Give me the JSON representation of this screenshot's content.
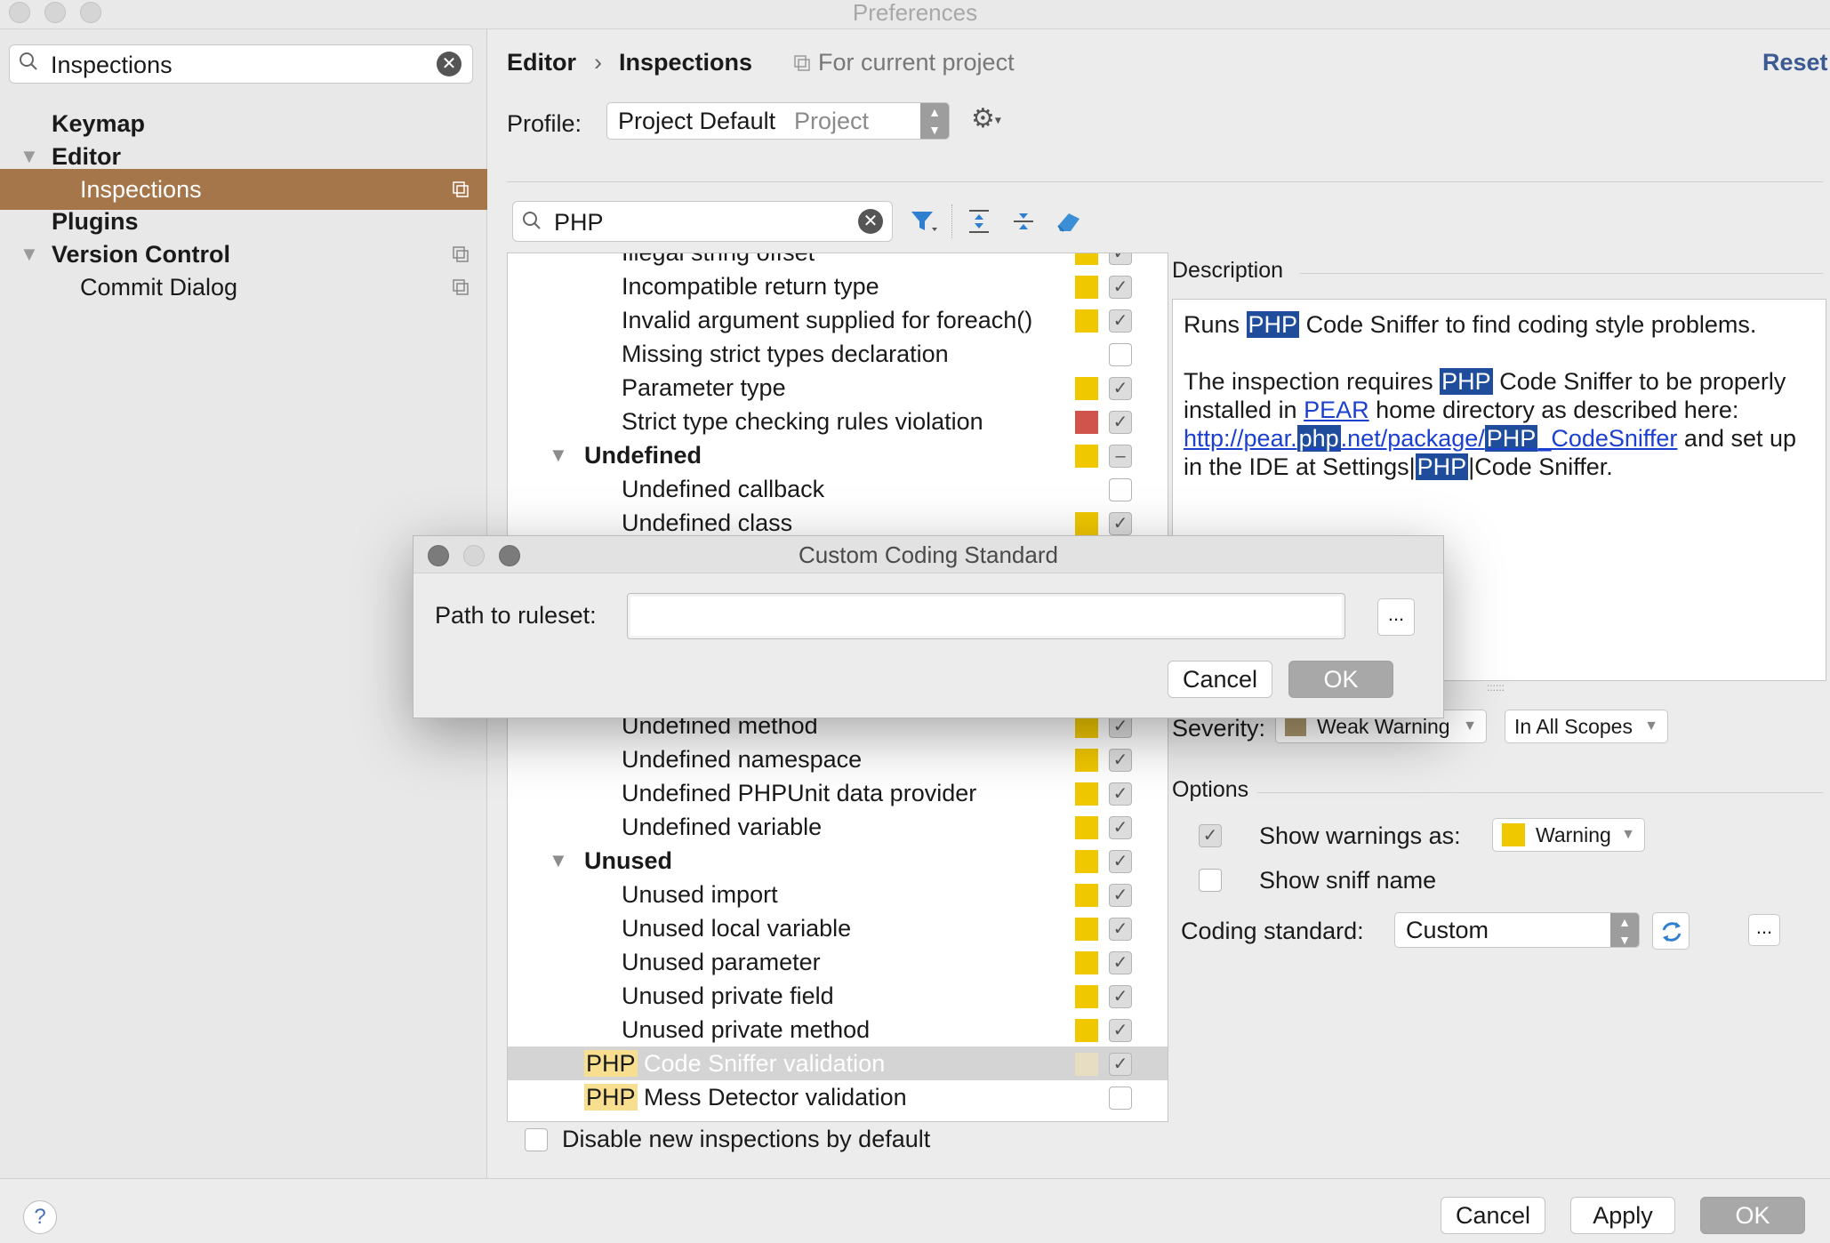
{
  "window": {
    "title": "Preferences"
  },
  "sidebar": {
    "search_value": "Inspections",
    "items": [
      {
        "label": "Keymap",
        "bold": true
      },
      {
        "label": "Editor",
        "bold": true
      },
      {
        "label": "Inspections",
        "selected": true
      },
      {
        "label": "Plugins",
        "bold": true
      },
      {
        "label": "Version Control",
        "bold": true
      },
      {
        "label": "Commit Dialog"
      }
    ]
  },
  "header": {
    "crumb1": "Editor",
    "sep": "›",
    "crumb2": "Inspections",
    "scope": "For current project",
    "reset": "Reset"
  },
  "profile": {
    "label": "Profile:",
    "value": "Project Default",
    "kind": "Project"
  },
  "filter": {
    "value": "PHP"
  },
  "tree": {
    "rows": [
      {
        "text": "Illegal string offset"
      },
      {
        "text": "Incompatible return type"
      },
      {
        "text": "Invalid argument supplied for foreach()"
      },
      {
        "text": "Missing strict types declaration"
      },
      {
        "text": "Parameter type"
      },
      {
        "text": "Strict type checking rules violation"
      },
      {
        "text": "Undefined"
      },
      {
        "text": "Undefined callback"
      },
      {
        "text": "Undefined class"
      },
      {
        "text": "Undefined method"
      },
      {
        "text": "Undefined namespace"
      },
      {
        "text": "Undefined PHPUnit data provider"
      },
      {
        "text": "Undefined variable"
      },
      {
        "text": "Unused"
      },
      {
        "text": "Unused import"
      },
      {
        "text": "Unused local variable"
      },
      {
        "text": "Unused parameter"
      },
      {
        "text": "Unused private field"
      },
      {
        "text": "Unused private method"
      },
      {
        "prefix": "PHP",
        "text": " Code Sniffer validation"
      },
      {
        "prefix": "PHP",
        "text": " Mess Detector validation"
      }
    ],
    "disable_new_label": "Disable new inspections by default"
  },
  "colors": {
    "warning": "#f0c800",
    "error": "#d0534c",
    "weak_warning": "#a8956b",
    "selection": "#a5764a",
    "highlight": "#1f4d9c"
  },
  "description": {
    "title": "Description",
    "p1_a": "Runs ",
    "php": "PHP",
    "p1_b": " Code Sniffer to find coding style problems.",
    "p2_a": "The inspection requires ",
    "p2_b": " Code Sniffer to be properly installed in ",
    "pear": "PEAR",
    "p2_c": " home directory as described here: ",
    "link_a": "http://pear.",
    "link_php": "php",
    "link_b": ".net/package/",
    "link_php2": "PHP",
    "link_c": "_CodeSniffer",
    "p2_d": " and set up in the IDE at Settings|",
    "p2_e": "|Code Sniffer."
  },
  "severity": {
    "label": "Severity:",
    "value": "Weak Warning",
    "scope": "In All Scopes"
  },
  "options": {
    "title": "Options",
    "show_warnings_label": "Show warnings as:",
    "show_warnings_value": "Warning",
    "show_sniff_label": "Show sniff name",
    "coding_standard_label": "Coding standard:",
    "coding_standard_value": "Custom",
    "browse": "..."
  },
  "dialog": {
    "title": "Custom Coding Standard",
    "path_label": "Path to ruleset:",
    "path_value": "",
    "browse": "...",
    "cancel": "Cancel",
    "ok": "OK"
  },
  "footer": {
    "help": "?",
    "cancel": "Cancel",
    "apply": "Apply",
    "ok": "OK"
  }
}
